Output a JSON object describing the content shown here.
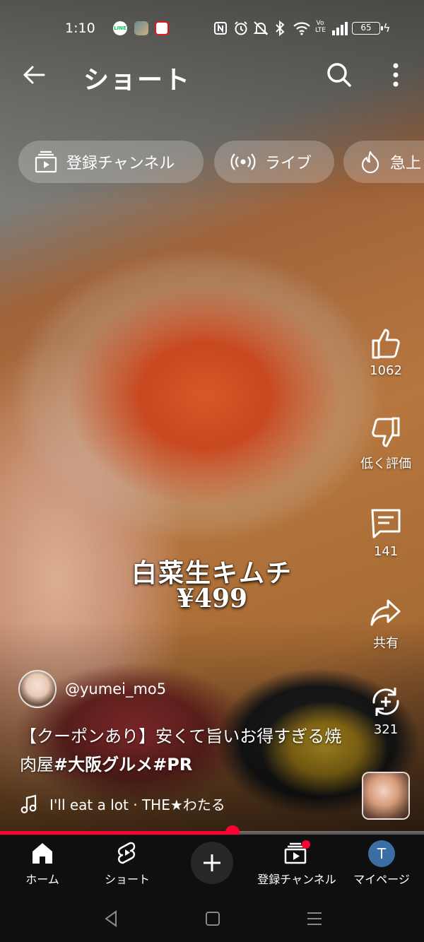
{
  "status_bar": {
    "time": "1:10",
    "apps": [
      "LINE",
      "photo",
      "news"
    ],
    "icons": [
      "nfc-icon",
      "alarm-icon",
      "mute-icon",
      "bluetooth-icon",
      "wifi-icon",
      "volte-icon",
      "signal-icon"
    ],
    "volte": "Vo LTE",
    "battery": "65"
  },
  "top_bar": {
    "title": "ショート"
  },
  "chips": [
    {
      "label": "登録チャンネル",
      "icon": "subscriptions-icon"
    },
    {
      "label": "ライブ",
      "icon": "live-icon"
    },
    {
      "label": "急上",
      "icon": "trending-icon"
    }
  ],
  "video": {
    "overlay_line1": "白菜生キムチ",
    "overlay_line2": "¥499",
    "progress": 0.548
  },
  "actions": {
    "like_count": "1062",
    "dislike_label": "低く評価",
    "comment_count": "141",
    "share_label": "共有",
    "remix_count": "321"
  },
  "channel": {
    "handle": "@yumei_mo5"
  },
  "caption": {
    "text_part1": "【クーポンあり】安くて旨いお得すぎる焼肉屋",
    "hashtag1": "#大阪グルメ",
    "hashtag2": "#PR"
  },
  "music": {
    "track": "I'll eat a lot · THE★わたる"
  },
  "bottom_nav": {
    "home": "ホーム",
    "shorts": "ショート",
    "subscriptions": "登録チャンネル",
    "mypage": "マイページ",
    "avatar_letter": "T",
    "accent": "#ff0033"
  }
}
